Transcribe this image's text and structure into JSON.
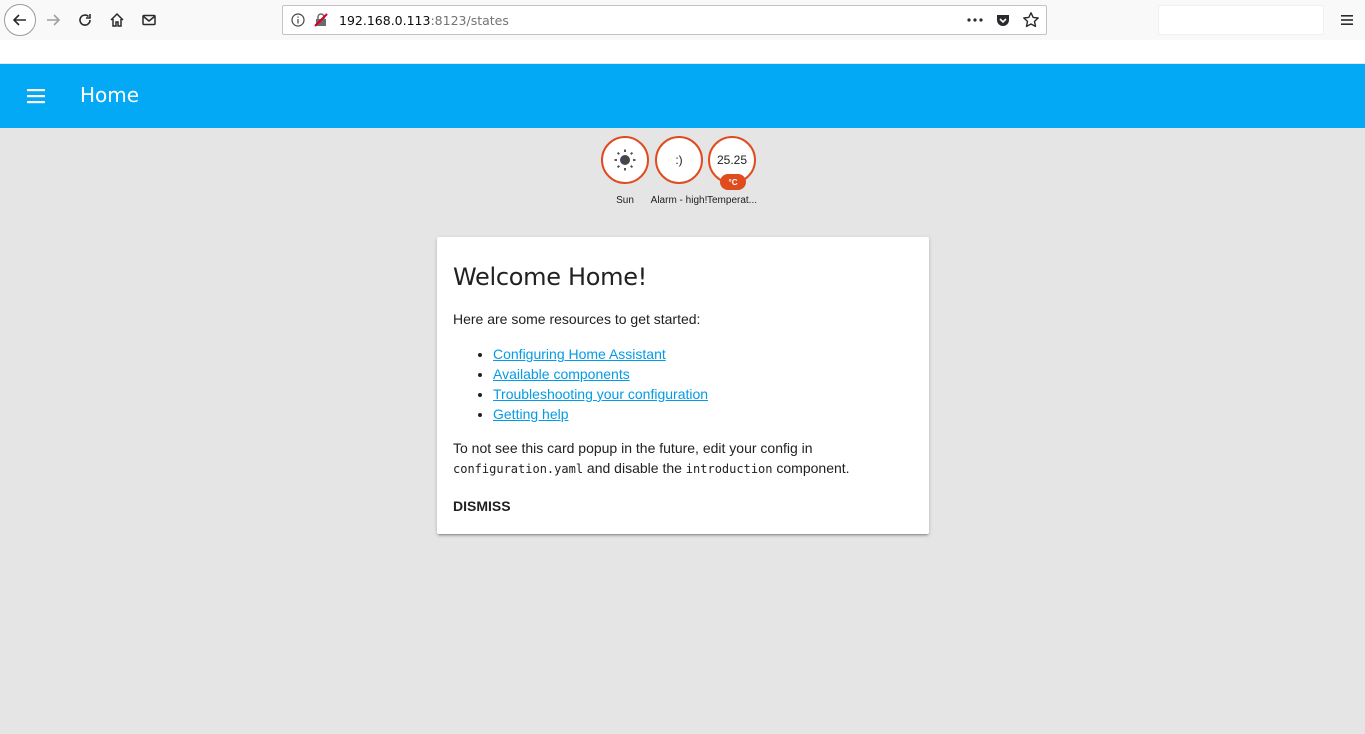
{
  "browser": {
    "url_host": "192.168.0.113",
    "url_rest": ":8123/states"
  },
  "header": {
    "title": "Home"
  },
  "badges": [
    {
      "value": "",
      "icon": "sun-icon",
      "label": "Sun"
    },
    {
      "value": ":)",
      "label": "Alarm - high!"
    },
    {
      "value": "25.25",
      "unit": "°C",
      "label": "Temperat..."
    }
  ],
  "card": {
    "title": "Welcome Home!",
    "intro": "Here are some resources to get started:",
    "links": [
      "Configuring Home Assistant",
      "Available components",
      "Troubleshooting your configuration",
      "Getting help"
    ],
    "note_part1": "To not see this card popup in the future, edit your config in",
    "note_code1": "configuration.yaml",
    "note_part2": " and disable the ",
    "note_code2": "introduction",
    "note_part3": " component.",
    "dismiss_label": "DISMISS"
  },
  "colors": {
    "header_bg": "#03a9f4",
    "badge_border": "#df4c1e",
    "link": "#039be5",
    "page_bg": "#e5e5e5"
  }
}
